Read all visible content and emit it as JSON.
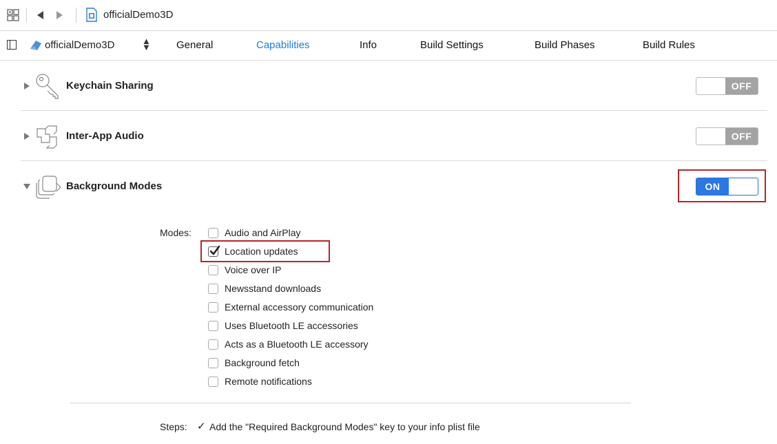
{
  "pathbar": {
    "file_name": "officialDemo3D"
  },
  "tabbar": {
    "target_name": "officialDemo3D",
    "tabs": [
      {
        "label": "General",
        "active": false
      },
      {
        "label": "Capabilities",
        "active": true
      },
      {
        "label": "Info",
        "active": false
      },
      {
        "label": "Build Settings",
        "active": false
      },
      {
        "label": "Build Phases",
        "active": false
      },
      {
        "label": "Build Rules",
        "active": false
      }
    ]
  },
  "capabilities": [
    {
      "name": "Keychain Sharing",
      "icon": "key-icon",
      "state": "OFF",
      "expanded": false
    },
    {
      "name": "Inter-App Audio",
      "icon": "inter-app-audio-icon",
      "state": "OFF",
      "expanded": false
    },
    {
      "name": "Background Modes",
      "icon": "background-modes-icon",
      "state": "ON",
      "expanded": true
    }
  ],
  "background_modes": {
    "modes_label": "Modes:",
    "modes": [
      {
        "label": "Audio and AirPlay",
        "checked": false
      },
      {
        "label": "Location updates",
        "checked": true
      },
      {
        "label": "Voice over IP",
        "checked": false
      },
      {
        "label": "Newsstand downloads",
        "checked": false
      },
      {
        "label": "External accessory communication",
        "checked": false
      },
      {
        "label": "Uses Bluetooth LE accessories",
        "checked": false
      },
      {
        "label": "Acts as a Bluetooth LE accessory",
        "checked": false
      },
      {
        "label": "Background fetch",
        "checked": false
      },
      {
        "label": "Remote notifications",
        "checked": false
      }
    ],
    "steps_label": "Steps:",
    "steps": [
      {
        "text": "Add the \"Required Background Modes\" key to your info plist file",
        "done": true
      }
    ]
  },
  "colors": {
    "accent": "#1d7bd9",
    "switch_on": "#2b78e4",
    "switch_off": "#a3a3a3",
    "highlight": "#b3262a"
  }
}
